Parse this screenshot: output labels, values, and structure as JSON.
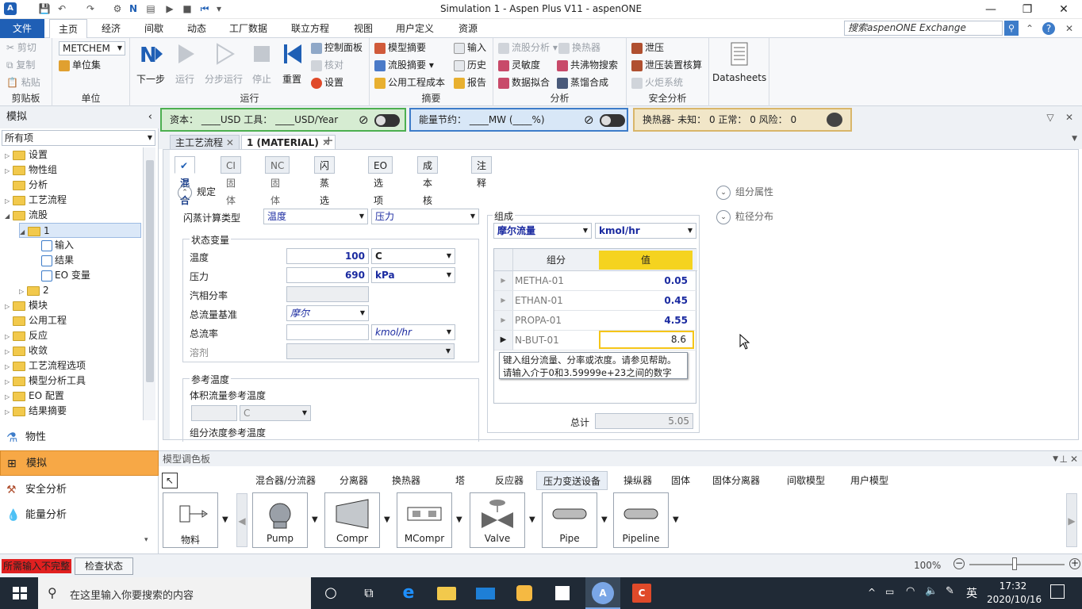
{
  "window": {
    "title": "Simulation 1 - Aspen Plus V11 - aspenONE",
    "minimize_icon": "—",
    "restore_icon": "❐",
    "close_icon": "✕"
  },
  "ribbon_tabs": [
    "文件",
    "主页",
    "经济",
    "间歇",
    "动态",
    "工厂数据",
    "联立方程",
    "视图",
    "用户定义",
    "资源"
  ],
  "search": {
    "placeholder": "搜索aspenONE Exchange"
  },
  "ribbon": {
    "clipboard": {
      "cut": "剪切",
      "copy": "复制",
      "paste": "粘贴",
      "label": "剪贴板"
    },
    "units": {
      "unit_set_value": "METCHEM",
      "unit_set_button": "单位集",
      "label": "单位"
    },
    "run": {
      "next": "下一步",
      "run": "运行",
      "step": "分步运行",
      "stop": "停止",
      "reset": "重置",
      "control_panel": "控制面板",
      "check": "核对",
      "settings": "设置",
      "label": "运行"
    },
    "summary": {
      "model_summary": "模型摘要",
      "stream_summary": "流股摘要",
      "utility_cost": "公用工程成本",
      "input": "输入",
      "history": "历史",
      "report": "报告",
      "label": "摘要"
    },
    "analysis": {
      "stream_analysis": "流股分析",
      "heat_exchanger": "换热器",
      "sensitivity": "灵敏度",
      "azeotrope_search": "共沸物搜索",
      "data_fit": "数据拟合",
      "distillation_synthesis": "蒸馏合成",
      "label": "分析"
    },
    "safety": {
      "pressure_relief": "泄压",
      "relief_check": "泄压装置核算",
      "flare_system": "火炬系统",
      "label": "安全分析"
    },
    "datasheets": "Datasheets"
  },
  "notifications": {
    "capital": "资本： ____USD   工具： ____USD/Year",
    "energy": "能量节约： ____MW   (____%)",
    "heat_exchanger": "换热器-  未知：  0   正常：  0   风险：  0"
  },
  "left_panel": {
    "title": "模拟",
    "filter": "所有项",
    "tree": [
      {
        "label": "设置",
        "indent": 0
      },
      {
        "label": "物性组",
        "indent": 0
      },
      {
        "label": "分析",
        "indent": 0
      },
      {
        "label": "工艺流程",
        "indent": 0
      },
      {
        "label": "流股",
        "indent": 0
      },
      {
        "label": "1",
        "indent": 1
      },
      {
        "label": "输入",
        "indent": 2
      },
      {
        "label": "结果",
        "indent": 2
      },
      {
        "label": "EO 变量",
        "indent": 2
      },
      {
        "label": "2",
        "indent": 1
      },
      {
        "label": "模块",
        "indent": 0
      },
      {
        "label": "公用工程",
        "indent": 0
      },
      {
        "label": "反应",
        "indent": 0
      },
      {
        "label": "收敛",
        "indent": 0
      },
      {
        "label": "工艺流程选项",
        "indent": 0
      },
      {
        "label": "模型分析工具",
        "indent": 0
      },
      {
        "label": "EO 配置",
        "indent": 0
      },
      {
        "label": "结果摘要",
        "indent": 0
      }
    ],
    "nav": [
      "物性",
      "模拟",
      "安全分析",
      "能量分析"
    ]
  },
  "doc_tabs": [
    "主工艺流程",
    "1 (MATERIAL)"
  ],
  "sub_tabs": [
    "混合",
    "CI 固体",
    "NC 固体",
    "闪蒸选项",
    "EO 选项",
    "成本核算",
    "注释"
  ],
  "form": {
    "spec_header": "规定",
    "flash_type_label": "闪蒸计算类型",
    "flash_type_1": "温度",
    "flash_type_2": "压力",
    "state_vars_title": "状态变量",
    "temp_label": "温度",
    "temp_value": "100",
    "temp_unit": "C",
    "pres_label": "压力",
    "pres_value": "690",
    "pres_unit": "kPa",
    "vapor_frac_label": "汽相分率",
    "flow_basis_label": "总流量基准",
    "flow_basis_value": "摩尔",
    "flow_rate_label": "总流率",
    "flow_rate_unit": "kmol/hr",
    "solvent_label": "溶剂",
    "ref_temp_title": "参考温度",
    "vol_flow_ref_label": "体积流量参考温度",
    "vol_flow_ref_unit": "C",
    "comp_conc_ref_label": "组分浓度参考温度",
    "composition_title": "组成",
    "comp_basis": "摩尔流量",
    "comp_unit": "kmol/hr",
    "col_component": "组分",
    "col_value": "值",
    "components": [
      {
        "name": "METHA-01",
        "value": "0.05"
      },
      {
        "name": "ETHAN-01",
        "value": "0.45"
      },
      {
        "name": "PROPA-01",
        "value": "4.55"
      },
      {
        "name": "N-BUT-01",
        "value": "8.6"
      }
    ],
    "tooltip_line1": "键入组分流量、分率或浓度。请参见帮助。",
    "tooltip_line2": "请输入介于0和3.59999e+23之间的数字",
    "total_label": "总计",
    "total_value": "5.05",
    "comp_props": "组分属性",
    "psd": "粒径分布"
  },
  "palette": {
    "title": "模型调色板",
    "tabs": [
      "混合器/分流器",
      "分离器",
      "换热器",
      "塔",
      "反应器",
      "压力变送设备",
      "操纵器",
      "固体",
      "固体分离器",
      "间歇模型",
      "用户模型"
    ],
    "items": [
      "物料",
      "Pump",
      "Compr",
      "MCompr",
      "Valve",
      "Pipe",
      "Pipeline"
    ]
  },
  "status": {
    "warning": "所需输入不完整",
    "check_status": "检查状态",
    "zoom": "100%"
  },
  "taskbar": {
    "search_placeholder": "在这里输入你要搜索的内容",
    "ime": "英",
    "time": "17:32",
    "date": "2020/10/16"
  },
  "colors": {
    "file_tab": "#1f5fb5",
    "value_blue": "#1a2aa0",
    "selected_header": "#f5d31f",
    "status_warning": "#e02020",
    "nav_active": "#f7a846"
  }
}
